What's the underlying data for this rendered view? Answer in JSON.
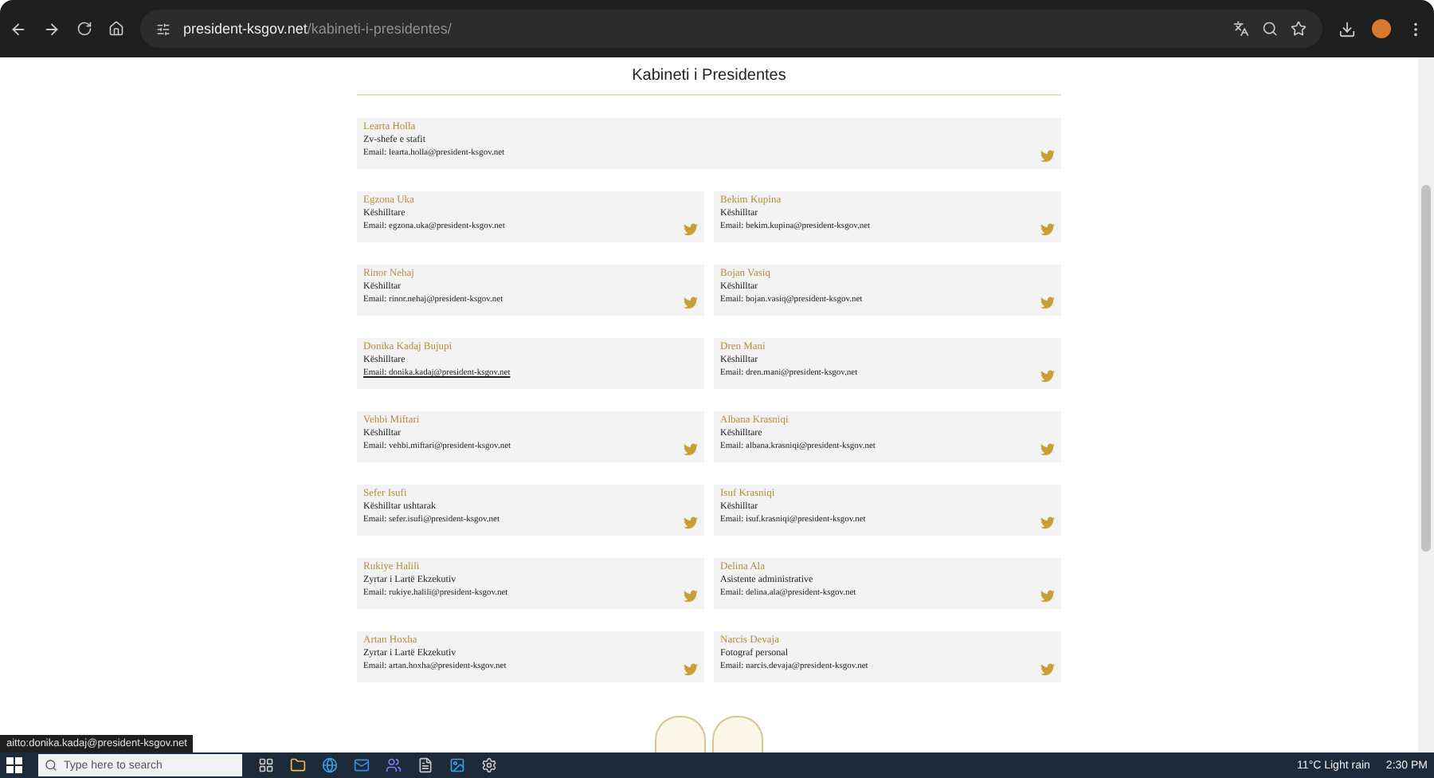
{
  "browser": {
    "url_domain": "president-ksgov.net",
    "url_path": "/kabineti-i-presidentes/"
  },
  "page": {
    "title": "Kabineti i Presidentes"
  },
  "staff": [
    {
      "name": "Learta Holla",
      "role": "Zv-shefe e stafit",
      "email": "Email: learta.holla@president-ksgov.net",
      "twitter": true,
      "wide": true,
      "email_hovered": false
    },
    {
      "name": "Egzona Uka",
      "role": "Këshilltare",
      "email": "Email: egzona.uka@president-ksgov.net",
      "twitter": true,
      "wide": false,
      "email_hovered": false
    },
    {
      "name": "Bekim Kupina",
      "role": "Këshilltar",
      "email": "Email: bekim.kupina@president-ksgov.net",
      "twitter": true,
      "wide": false,
      "email_hovered": false
    },
    {
      "name": "Rinor Nehaj",
      "role": "Këshilltar",
      "email": "Email: rinor.nehaj@president-ksgov.net",
      "twitter": true,
      "wide": false,
      "email_hovered": false
    },
    {
      "name": "Bojan Vasiq",
      "role": "Këshilltar",
      "email": "Email: bojan.vasiq@president-ksgov.net",
      "twitter": true,
      "wide": false,
      "email_hovered": false
    },
    {
      "name": "Donika Kadaj Bujupi",
      "role": "Këshilltare",
      "email": "Email: donika.kadaj@president-ksgov.net",
      "twitter": false,
      "wide": false,
      "email_hovered": true
    },
    {
      "name": "Dren Mani",
      "role": "Këshilltar",
      "email": "Email: dren.mani@president-ksgov.net",
      "twitter": true,
      "wide": false,
      "email_hovered": false
    },
    {
      "name": "Vehbi Miftari",
      "role": "Këshilltar",
      "email": "Email: vehbi.miftari@president-ksgov.net",
      "twitter": true,
      "wide": false,
      "email_hovered": false
    },
    {
      "name": "Albana Krasniqi",
      "role": "Këshilltare",
      "email": "Email: albana.krasniqi@president-ksgov.net",
      "twitter": true,
      "wide": false,
      "email_hovered": false
    },
    {
      "name": "Sefer Isufi",
      "role": "Këshilltar ushtarak",
      "email": "Email: sefer.isufi@president-ksgov.net",
      "twitter": true,
      "wide": false,
      "email_hovered": false
    },
    {
      "name": "Isuf Krasniqi",
      "role": "Këshilltar",
      "email": "Email: isuf.krasniqi@president-ksgov.net",
      "twitter": true,
      "wide": false,
      "email_hovered": false
    },
    {
      "name": "Rukiye Halili",
      "role": "Zyrtar i Lartë Ekzekutiv",
      "email": "Email: rukiye.halili@president-ksgov.net",
      "twitter": true,
      "wide": false,
      "email_hovered": false
    },
    {
      "name": "Delina Ala",
      "role": "Asistente administrative",
      "email": "Email: delina.ala@president-ksgov.net",
      "twitter": true,
      "wide": false,
      "email_hovered": false
    },
    {
      "name": "Artan Hoxha",
      "role": "Zyrtar i Lartë Ekzekutiv",
      "email": "Email: artan.hoxha@president-ksgov.net",
      "twitter": true,
      "wide": false,
      "email_hovered": false
    },
    {
      "name": "Narcis Devaja",
      "role": "Fotograf personal",
      "email": "Email: narcis.devaja@president-ksgov.net",
      "twitter": true,
      "wide": false,
      "email_hovered": false
    }
  ],
  "status_link": "aitto:donika.kadaj@president-ksgov.net",
  "taskbar": {
    "search_placeholder": "Type here to search",
    "weather": "11°C  Light rain",
    "time": "2:30 PM"
  }
}
